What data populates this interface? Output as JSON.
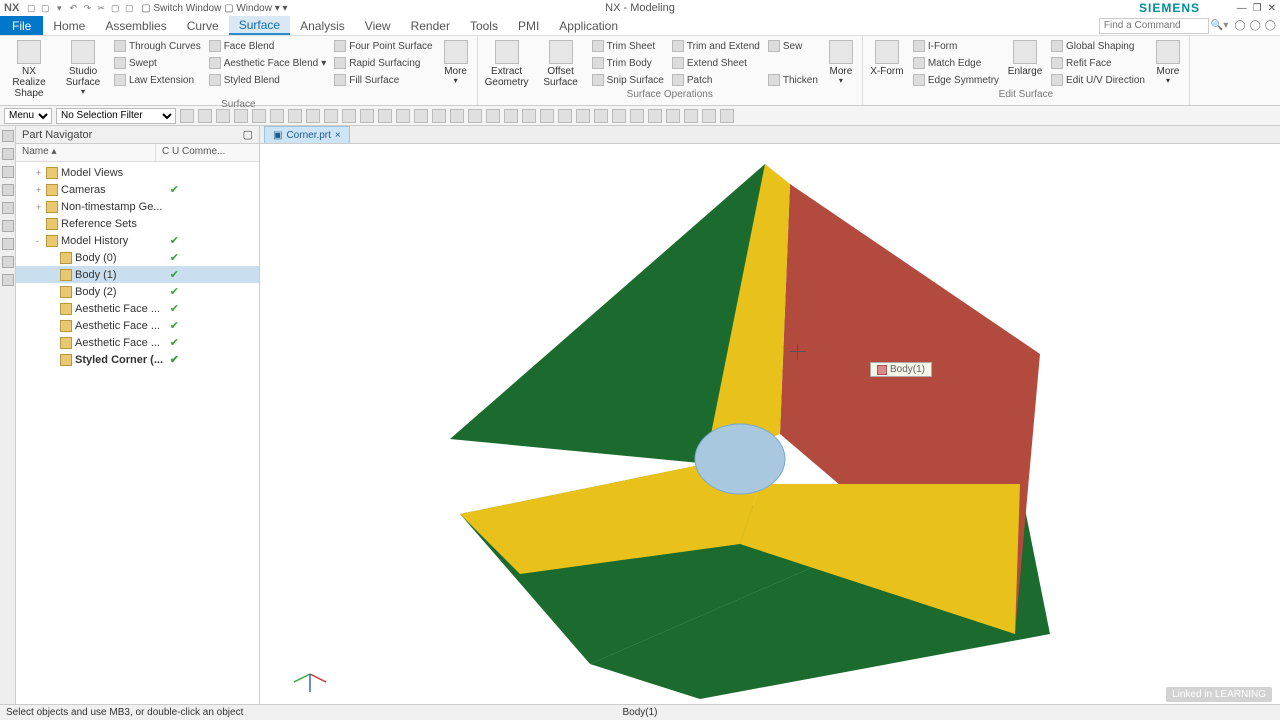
{
  "title": {
    "app": "NX - Modeling",
    "brand": "SIEMENS",
    "nx": "NX",
    "switch_window": "Switch Window",
    "window_menu": "Window"
  },
  "menubar": {
    "file": "File",
    "tabs": [
      "Home",
      "Assemblies",
      "Curve",
      "Surface",
      "Analysis",
      "View",
      "Render",
      "Tools",
      "PMI",
      "Application"
    ],
    "active_index": 3,
    "search_placeholder": "Find a Command"
  },
  "ribbon": {
    "groups": [
      {
        "label": "Surface",
        "big": [
          {
            "l1": "NX Realize",
            "l2": "Shape"
          },
          {
            "l1": "Studio",
            "l2": "Surface"
          }
        ],
        "cols": [
          [
            "Through Curves",
            "Swept",
            "Law Extension"
          ],
          [
            "Face Blend",
            "Aesthetic Face Blend",
            "Styled Blend"
          ],
          [
            "Four Point Surface",
            "Rapid Surfacing",
            "Fill Surface"
          ]
        ],
        "more": "More"
      },
      {
        "label": "Surface Operations",
        "big": [
          {
            "l1": "Extract",
            "l2": "Geometry"
          },
          {
            "l1": "Offset",
            "l2": "Surface"
          }
        ],
        "cols": [
          [
            "Trim Sheet",
            "Trim Body",
            "Snip Surface"
          ],
          [
            "Trim and Extend",
            "Extend Sheet",
            "Patch"
          ],
          [
            "Sew",
            "",
            "Thicken"
          ]
        ],
        "more": "More"
      },
      {
        "label": "Edit Surface",
        "big": [
          {
            "l1": "X-Form",
            "l2": ""
          },
          {
            "l1": "Enlarge",
            "l2": ""
          }
        ],
        "cols": [
          [
            "I-Form",
            "Match Edge",
            "Edge Symmetry"
          ],
          [
            "Global Shaping",
            "Refit Face",
            "Edit U/V Direction"
          ]
        ],
        "more": "More"
      }
    ]
  },
  "toolbar2": {
    "menu": "Menu",
    "filter": "No Selection Filter"
  },
  "navigator": {
    "title": "Part Navigator",
    "col_name": "Name",
    "col_rest": "C  U  Comme...",
    "items": [
      {
        "label": "Model Views",
        "indent": 1,
        "exp": "+",
        "check": false
      },
      {
        "label": "Cameras",
        "indent": 1,
        "exp": "+",
        "check": true
      },
      {
        "label": "Non-timestamp Ge...",
        "indent": 1,
        "exp": "+",
        "check": false
      },
      {
        "label": "Reference Sets",
        "indent": 1,
        "exp": "",
        "check": false
      },
      {
        "label": "Model History",
        "indent": 1,
        "exp": "-",
        "check": true
      },
      {
        "label": "Body (0)",
        "indent": 2,
        "exp": "",
        "check": true
      },
      {
        "label": "Body (1)",
        "indent": 2,
        "exp": "",
        "check": true,
        "sel": true
      },
      {
        "label": "Body (2)",
        "indent": 2,
        "exp": "",
        "check": true
      },
      {
        "label": "Aesthetic Face ...",
        "indent": 2,
        "exp": "",
        "check": true
      },
      {
        "label": "Aesthetic Face ...",
        "indent": 2,
        "exp": "",
        "check": true
      },
      {
        "label": "Aesthetic Face ...",
        "indent": 2,
        "exp": "",
        "check": true
      },
      {
        "label": "Styled Corner (...",
        "indent": 2,
        "exp": "",
        "check": true,
        "bold": true
      }
    ]
  },
  "filetab": {
    "name": "Corner.prt"
  },
  "viewport": {
    "tooltip": "Body(1)"
  },
  "statusbar": {
    "left": "Select objects and use MB3, or double-click an object",
    "mid": "Body(1)"
  },
  "overlay": {
    "linkedin": "Linked in LEARNING"
  }
}
